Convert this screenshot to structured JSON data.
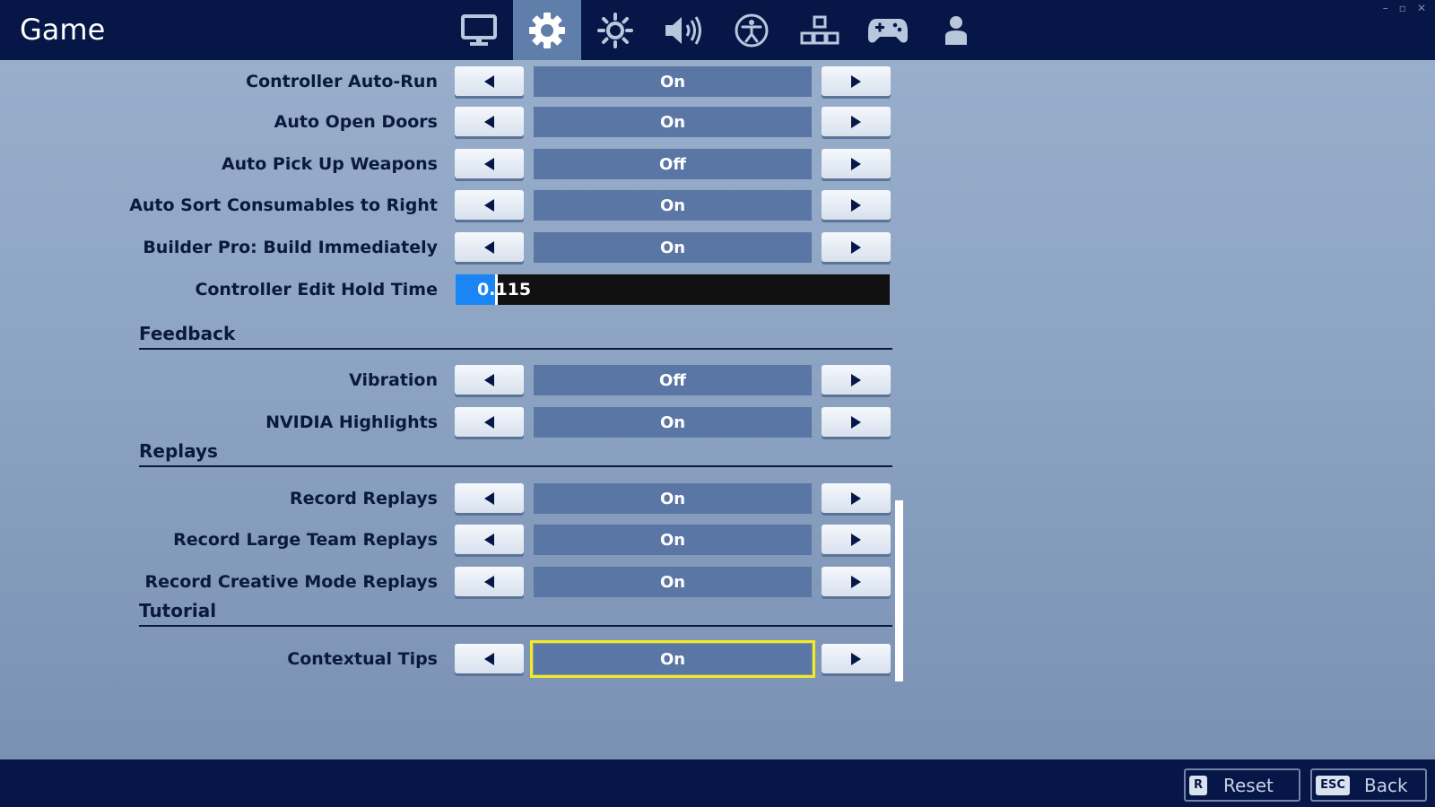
{
  "header": {
    "title": "Game",
    "tabs": [
      {
        "icon": "monitor-icon",
        "active": false
      },
      {
        "icon": "gear-icon",
        "active": true
      },
      {
        "icon": "brightness-icon",
        "active": false
      },
      {
        "icon": "speaker-icon",
        "active": false
      },
      {
        "icon": "accessibility-icon",
        "active": false
      },
      {
        "icon": "input-layout-icon",
        "active": false
      },
      {
        "icon": "gamepad-icon",
        "active": false
      },
      {
        "icon": "account-icon",
        "active": false
      }
    ]
  },
  "window_controls": {
    "minimize": "–",
    "restore": "▫",
    "close": "✕"
  },
  "settings": {
    "controller_auto_run": {
      "label": "Controller Auto-Run",
      "value": "On"
    },
    "auto_open_doors": {
      "label": "Auto Open Doors",
      "value": "On"
    },
    "auto_pick_up_weapons": {
      "label": "Auto Pick Up Weapons",
      "value": "Off"
    },
    "auto_sort_consumables": {
      "label": "Auto Sort Consumables to Right",
      "value": "On"
    },
    "builder_pro": {
      "label": "Builder Pro: Build Immediately",
      "value": "On"
    },
    "edit_hold_time": {
      "label": "Controller Edit Hold Time",
      "value": "0.115",
      "fill_fraction": 0.09
    },
    "vibration": {
      "label": "Vibration",
      "value": "Off"
    },
    "nvidia_highlights": {
      "label": "NVIDIA Highlights",
      "value": "On"
    },
    "record_replays": {
      "label": "Record Replays",
      "value": "On"
    },
    "record_large_team": {
      "label": "Record Large Team Replays",
      "value": "On"
    },
    "record_creative": {
      "label": "Record Creative Mode Replays",
      "value": "On"
    },
    "contextual_tips": {
      "label": "Contextual Tips",
      "value": "On"
    }
  },
  "sections": {
    "feedback": "Feedback",
    "replays": "Replays",
    "tutorial": "Tutorial"
  },
  "footer": {
    "reset": {
      "key": "R",
      "label": "Reset"
    },
    "back": {
      "key": "ESC",
      "label": "Back"
    }
  },
  "colors": {
    "accent_focus": "#f5ea1a",
    "slider_fill": "#1a86f5",
    "value_box": "#5a76a4",
    "bar_background": "#061646"
  }
}
